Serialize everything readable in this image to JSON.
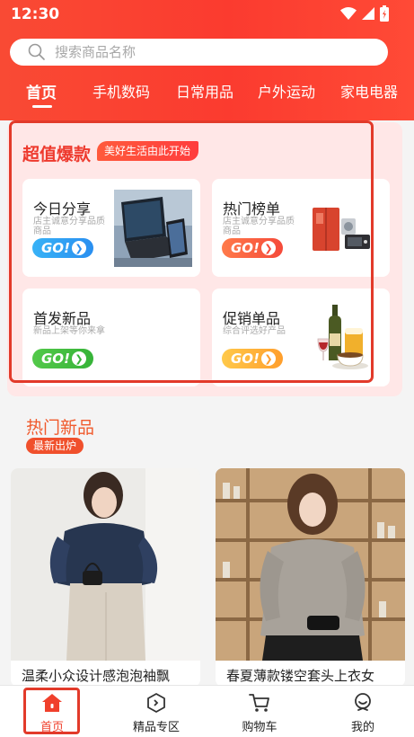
{
  "status_bar": {
    "time": "12:30"
  },
  "search": {
    "placeholder": "搜索商品名称"
  },
  "tabs": [
    {
      "label": "首页"
    },
    {
      "label": "手机数码"
    },
    {
      "label": "日常用品"
    },
    {
      "label": "户外运动"
    },
    {
      "label": "家电电器"
    }
  ],
  "promo": {
    "title": "超值爆款",
    "badge": "美好生活由此开始",
    "cards": [
      {
        "title": "今日分享",
        "subtitle": "店主诚意分享品质商品",
        "go_label": "GO!",
        "image": "laptop-tablet-image"
      },
      {
        "title": "热门榜单",
        "subtitle": "店主诚意分享品质商品",
        "go_label": "GO!",
        "image": "appliances-image"
      },
      {
        "title": "首发新品",
        "subtitle": "新品上架等你来拿",
        "go_label": "GO!",
        "image": ""
      },
      {
        "title": "促销单品",
        "subtitle": "综合评选好产品",
        "go_label": "GO!",
        "image": "wine-coffee-image"
      }
    ]
  },
  "hot_new": {
    "title": "热门新品",
    "badge": "最新出炉",
    "products": [
      {
        "name": "温柔小众设计感泡泡袖飘",
        "image": "woman-navy-blouse-photo"
      },
      {
        "name": "春夏薄款镂空套头上衣女",
        "image": "woman-knit-sweater-photo"
      }
    ]
  },
  "bottom_nav": [
    {
      "label": "首页",
      "icon": "home-icon"
    },
    {
      "label": "精品专区",
      "icon": "hexagon-icon"
    },
    {
      "label": "购物车",
      "icon": "cart-icon"
    },
    {
      "label": "我的",
      "icon": "profile-icon"
    }
  ],
  "colors": {
    "brand": "#f94a34",
    "promo_bg": "#ffe7e7",
    "highlight": "#e23a2a"
  }
}
